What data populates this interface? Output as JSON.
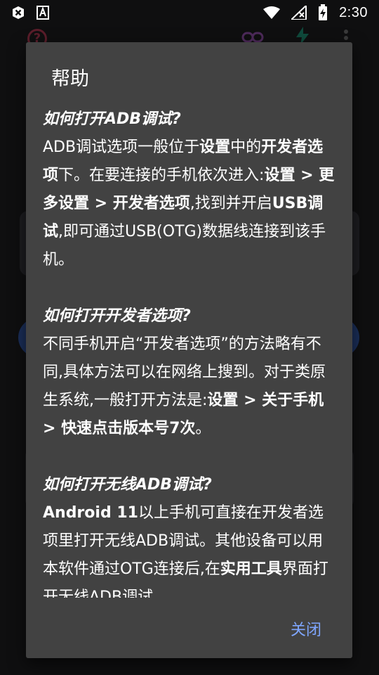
{
  "status_bar": {
    "time": "2:30",
    "icons": [
      "close-box-icon",
      "font-a-icon",
      "wifi-icon",
      "no-signal-icon",
      "battery-charging-icon"
    ]
  },
  "toolbar": {
    "icons": [
      "help-circle-icon",
      "link-icon",
      "bolt-icon",
      "more-vert-icon"
    ]
  },
  "dialog": {
    "title": "帮助",
    "close_label": "关闭",
    "sections": [
      {
        "title": "如何打开ADB调试?",
        "segments": [
          {
            "t": "ADB调试选项一般位于",
            "b": false
          },
          {
            "t": "设置",
            "b": true
          },
          {
            "t": "中的",
            "b": false
          },
          {
            "t": "开发者选项",
            "b": true
          },
          {
            "t": "下。在要连接的手机依次进入:",
            "b": false
          },
          {
            "t": "设置 > 更多设置 > 开发者选项",
            "b": true
          },
          {
            "t": ",找到并开启",
            "b": false
          },
          {
            "t": "USB调试",
            "b": true
          },
          {
            "t": ",即可通过USB(OTG)数据线连接到该手机。",
            "b": false
          }
        ]
      },
      {
        "title": "如何打开开发者选项?",
        "segments": [
          {
            "t": "不同手机开启“开发者选项”的方法略有不同,具体方法可以在网络上搜到。对于类原生系统,一般打开方法是:",
            "b": false
          },
          {
            "t": "设置 > 关于手机 > 快速点击版本号7次",
            "b": true
          },
          {
            "t": "。",
            "b": false
          }
        ]
      },
      {
        "title": "如何打开无线ADB调试?",
        "segments": [
          {
            "t": "Android 11",
            "b": true
          },
          {
            "t": "以上手机可直接在开发者选项里打开无线ADB调试。其他设备可以用本软件通过OTG连接后,在",
            "b": false
          },
          {
            "t": "实用工具",
            "b": true
          },
          {
            "t": "界面打开无线ADB调试",
            "b": false
          }
        ]
      }
    ]
  },
  "colors": {
    "dialog_bg": "#424242",
    "accent": "#7fa6ff",
    "background": "#0f0f10"
  }
}
